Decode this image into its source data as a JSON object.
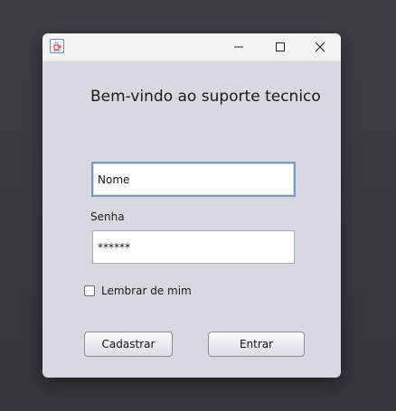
{
  "window": {
    "title": "",
    "icon": "java-cup-icon"
  },
  "titlebar_buttons": [
    "minimize-icon",
    "maximize-icon",
    "close-icon"
  ],
  "form": {
    "welcome_text": "Bem-vindo ao suporte tecnico",
    "name_field": {
      "value": "Nome"
    },
    "password_label": "Senha",
    "password_field": {
      "value": "******"
    },
    "remember_me": {
      "label": "Lembrar de mim",
      "checked": false
    },
    "buttons": {
      "register_label": "Cadastrar",
      "login_label": "Entrar"
    }
  },
  "colors": {
    "window_background": "#d6d9df",
    "titlebar_background": "#f3f3f3",
    "focused_border": "#7f9bb8",
    "desktop_background": "#3a3d40"
  }
}
